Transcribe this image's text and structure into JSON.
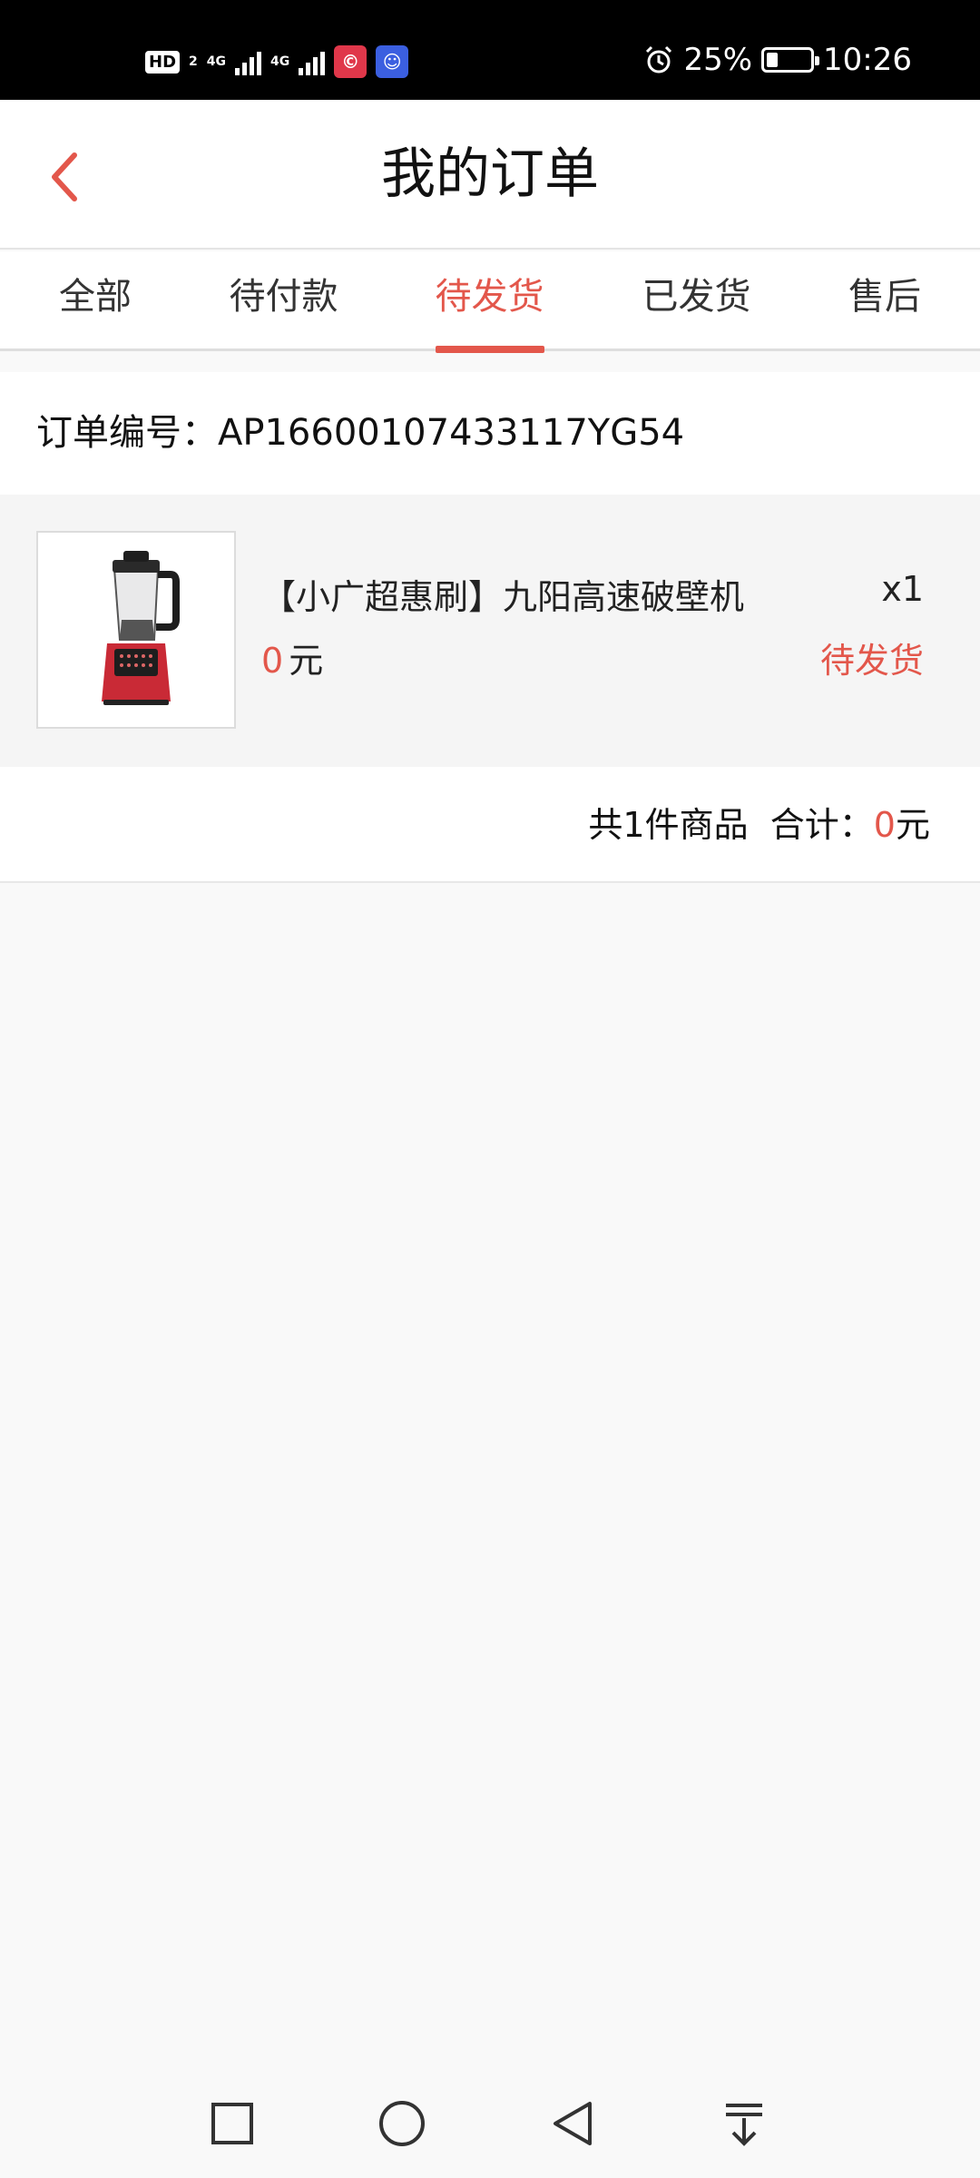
{
  "status_bar": {
    "hd_label": "HD",
    "hd_sub": "2",
    "signal1_label": "4G",
    "signal2_label": "4G",
    "battery_text": "25%",
    "battery_level": 0.25,
    "time": "10:26"
  },
  "header": {
    "title": "我的订单"
  },
  "tabs": [
    {
      "label": "全部"
    },
    {
      "label": "待付款"
    },
    {
      "label": "待发货"
    },
    {
      "label": "已发货"
    },
    {
      "label": "售后"
    }
  ],
  "active_tab_index": 2,
  "order": {
    "number_label": "订单编号：",
    "number": "AP16600107433117YG54",
    "item": {
      "name": "【小广超惠刷】九阳高速破壁机",
      "quantity": "x1",
      "price": "0",
      "price_unit": "元",
      "status": "待发货"
    },
    "summary": {
      "count_text": "共1件商品",
      "total_label": "合计：",
      "total": "0",
      "total_unit": "元"
    }
  },
  "colors": {
    "accent": "#e3574b",
    "background": "#f9f9f9"
  }
}
